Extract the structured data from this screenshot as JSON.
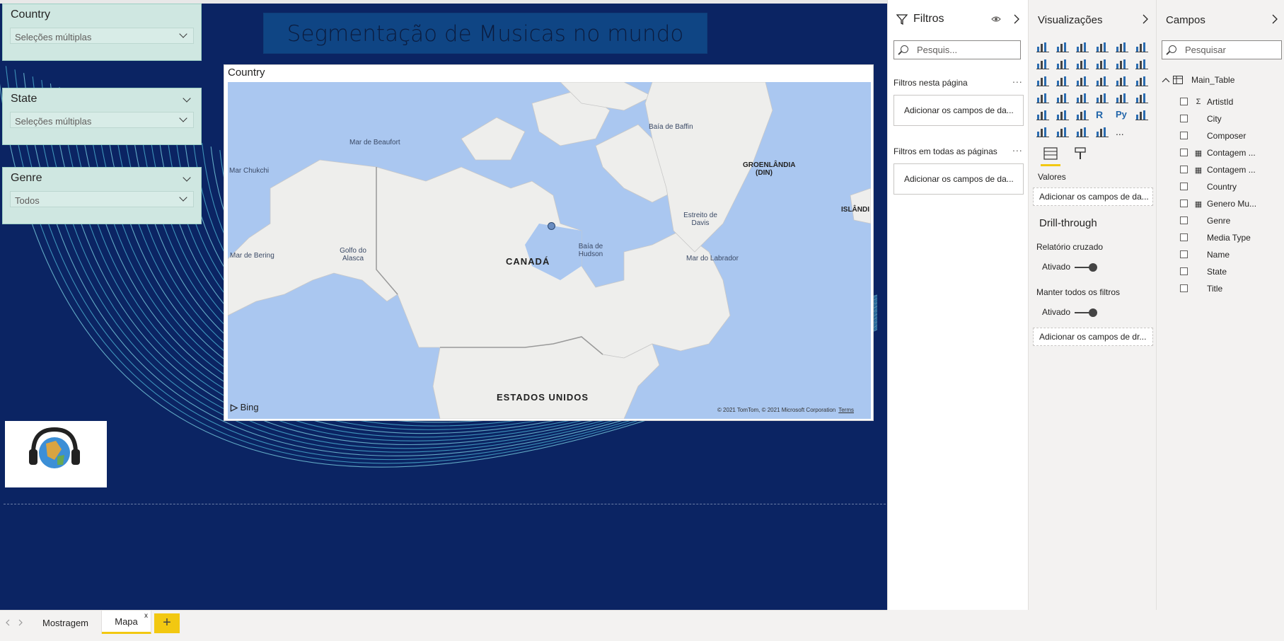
{
  "canvas": {
    "title": "Segmentação de Musicas no mundo",
    "slicers": [
      {
        "header": "Country",
        "value": "Seleções múltiplas"
      },
      {
        "header": "State",
        "value": "Seleções múltiplas"
      },
      {
        "header": "Genre",
        "value": "Todos"
      }
    ],
    "map_visual": {
      "title": "Country",
      "labels": {
        "baffin": "Baía de Baffin",
        "beaufort": "Mar de Beaufort",
        "chukchi": "Mar Chukchi",
        "groenlandia": "GROENLÂNDIA (DIN)",
        "islandia": "ISLÂNDI",
        "davis": "Estreito de Davis",
        "hudson": "Baía de Hudson",
        "bering": "Mar de Bering",
        "alasca": "Golfo do Alasca",
        "labrador": "Mar do Labrador",
        "canada": "CANADÁ",
        "eua": "ESTADOS UNIDOS"
      },
      "bing": "Bing",
      "copyright": "© 2021 TomTom, © 2021 Microsoft Corporation",
      "terms": "Terms"
    }
  },
  "filters_pane": {
    "title": "Filtros",
    "search_placeholder": "Pesquis...",
    "this_page_label": "Filtros nesta página",
    "this_page_well": "Adicionar os campos de da...",
    "all_pages_label": "Filtros em todas as páginas",
    "all_pages_well": "Adicionar os campos de da..."
  },
  "viz_pane": {
    "title": "Visualizações",
    "values_label": "Valores",
    "values_well": "Adicionar os campos de da...",
    "drillthrough_title": "Drill-through",
    "cross_report": "Relatório cruzado",
    "cross_report_state": "Ativado",
    "keep_filters": "Manter todos os filtros",
    "keep_filters_state": "Ativado",
    "drill_well": "Adicionar os campos de dr...",
    "r_label": "R",
    "py_label": "Py",
    "more": "..."
  },
  "fields_pane": {
    "title": "Campos",
    "search_placeholder": "Pesquisar",
    "table_name": "Main_Table",
    "fields": [
      {
        "name": "ArtistId",
        "type": "Σ"
      },
      {
        "name": "City",
        "type": ""
      },
      {
        "name": "Composer",
        "type": ""
      },
      {
        "name": "Contagem ...",
        "type": "calc"
      },
      {
        "name": "Contagem ...",
        "type": "calc"
      },
      {
        "name": "Country",
        "type": ""
      },
      {
        "name": "Genero Mu...",
        "type": "calc"
      },
      {
        "name": "Genre",
        "type": ""
      },
      {
        "name": "Media Type",
        "type": ""
      },
      {
        "name": "Name",
        "type": ""
      },
      {
        "name": "State",
        "type": ""
      },
      {
        "name": "Title",
        "type": ""
      }
    ]
  },
  "tabs": [
    {
      "label": "Mostragem",
      "active": false
    },
    {
      "label": "Mapa",
      "active": true
    }
  ],
  "tab_close": "x",
  "add_tab": "+",
  "colors": {
    "canvas_bg": "#0b2463",
    "slicer_bg": "#cfe7e1",
    "title_bg": "#0f4584",
    "accent_yellow": "#f2c811",
    "water": "#aac7f0"
  }
}
